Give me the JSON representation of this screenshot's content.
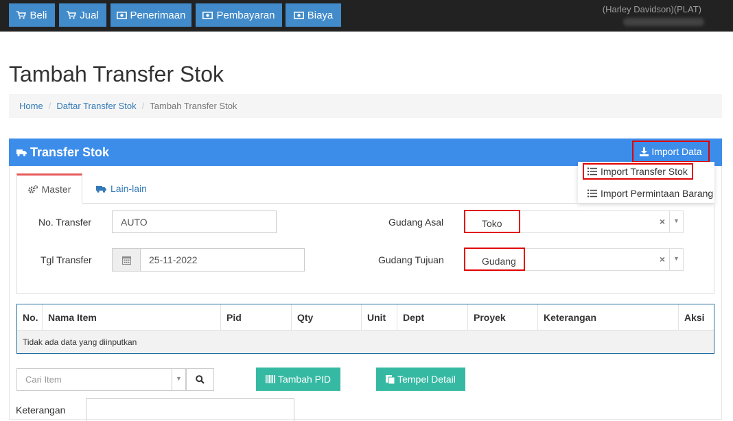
{
  "nav": [
    {
      "label": "Beli",
      "icon": "cart-icon"
    },
    {
      "label": "Jual",
      "icon": "cart-icon"
    },
    {
      "label": "Penerimaan",
      "icon": "money-icon"
    },
    {
      "label": "Pembayaran",
      "icon": "money-icon"
    },
    {
      "label": "Biaya",
      "icon": "money-icon"
    }
  ],
  "header": {
    "company": "(Harley Davidson)(PLAT)"
  },
  "page": {
    "title": "Tambah Transfer Stok"
  },
  "breadcrumb": [
    "Home",
    "Daftar Transfer Stok",
    "Tambah Transfer Stok"
  ],
  "panel": {
    "title": "Transfer Stok",
    "import_label": "Import Data",
    "import_menu": [
      "Import Transfer Stok",
      "Import Permintaan Barang"
    ]
  },
  "tabs": [
    {
      "label": "Master",
      "icon": "gears-icon",
      "active": true
    },
    {
      "label": "Lain-lain",
      "icon": "truck-icon",
      "active": false
    }
  ],
  "form": {
    "no_transfer_label": "No. Transfer",
    "no_transfer_value": "AUTO",
    "tgl_transfer_label": "Tgl Transfer",
    "tgl_transfer_value": "25-11-2022",
    "gudang_asal_label": "Gudang Asal",
    "gudang_asal_value": "Toko",
    "gudang_tujuan_label": "Gudang Tujuan",
    "gudang_tujuan_value": "Gudang"
  },
  "table": {
    "columns": [
      "No.",
      "Nama Item",
      "Pid",
      "Qty",
      "Unit",
      "Dept",
      "Proyek",
      "Keterangan",
      "Aksi"
    ],
    "empty_text": "Tidak ada data yang diinputkan"
  },
  "bottom": {
    "search_placeholder": "Cari Item",
    "tambah_pid_label": "Tambah PID",
    "tempel_detail_label": "Tempel Detail",
    "keterangan_label": "Keterangan"
  },
  "colors": {
    "nav_bg": "#222222",
    "primary": "#428bca",
    "panel_head": "#3c8dea",
    "accent_green": "#36b9a3",
    "highlight": "#e00000"
  }
}
